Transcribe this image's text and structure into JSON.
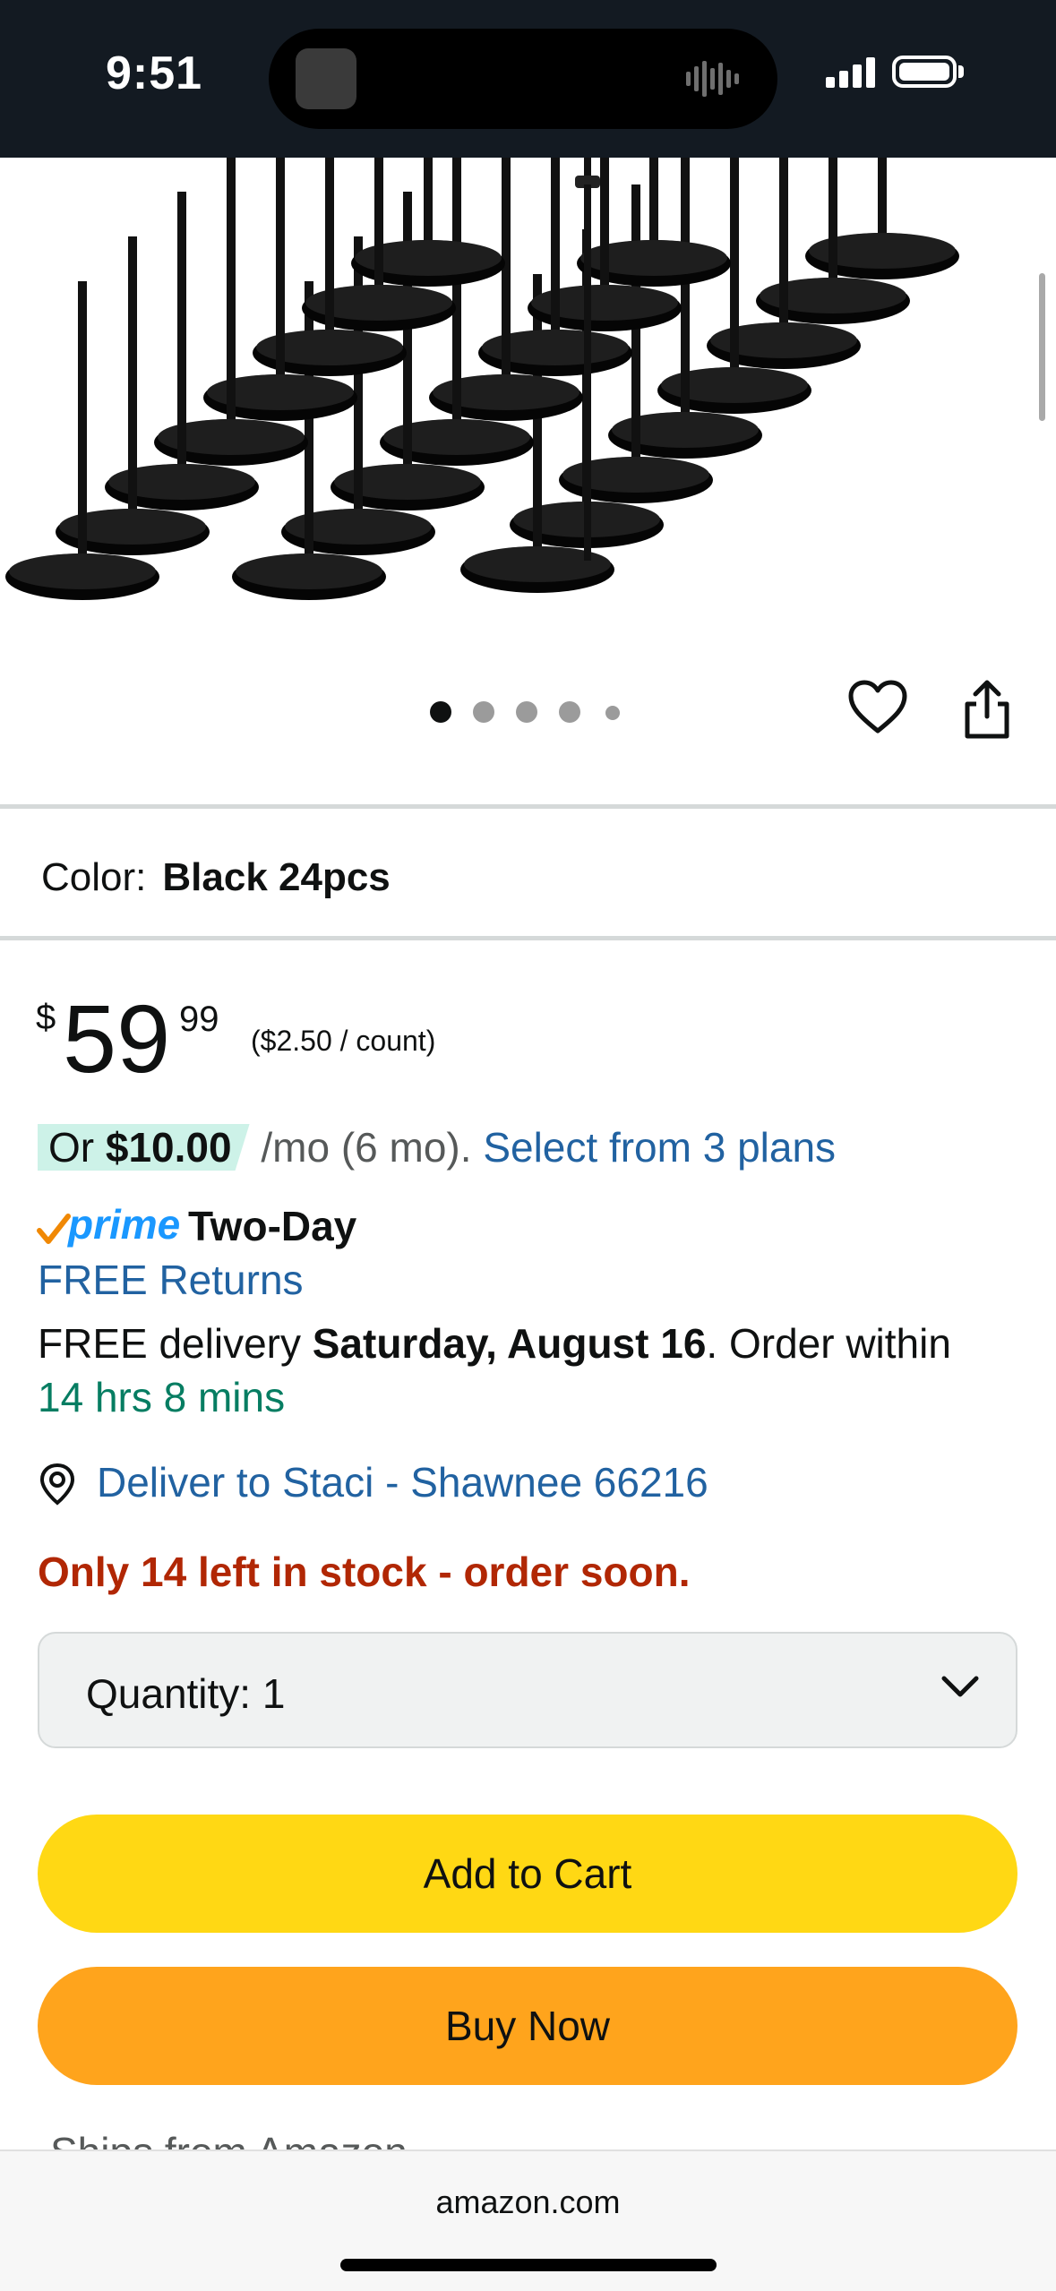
{
  "status_bar": {
    "time": "9:51"
  },
  "gallery": {
    "dot_count": 5,
    "active_dot": 0
  },
  "color": {
    "label": "Color:",
    "value": "Black 24pcs"
  },
  "price": {
    "currency": "$",
    "dollars": "59",
    "cents": "99",
    "unit_price": "($2.50 / count)"
  },
  "installment": {
    "or_text": "Or",
    "amount": "$10.00",
    "term": "/mo (6 mo).",
    "plans_link": "Select from 3 plans"
  },
  "shipping": {
    "prime_label": "prime",
    "speed": "Two-Day",
    "returns": "FREE Returns",
    "delivery_prefix": "FREE delivery",
    "delivery_date": "Saturday, August 16",
    "order_within": ". Order within",
    "countdown": "14 hrs 8 mins"
  },
  "deliver_to": "Deliver to Staci - Shawnee 66216",
  "stock": "Only 14 left in stock - order soon.",
  "quantity": {
    "label": "Quantity:",
    "value": "1"
  },
  "buttons": {
    "add_to_cart": "Add to Cart",
    "buy_now": "Buy Now"
  },
  "ships_from_partial": "Ships from Amazon",
  "browser": {
    "domain": "amazon.com"
  },
  "colors": {
    "add_to_cart": "#ffd814",
    "buy_now": "#ffa41c",
    "link": "#2162a1",
    "stock": "#b12704",
    "prime": "#1a98ff",
    "countdown": "#067d62"
  }
}
